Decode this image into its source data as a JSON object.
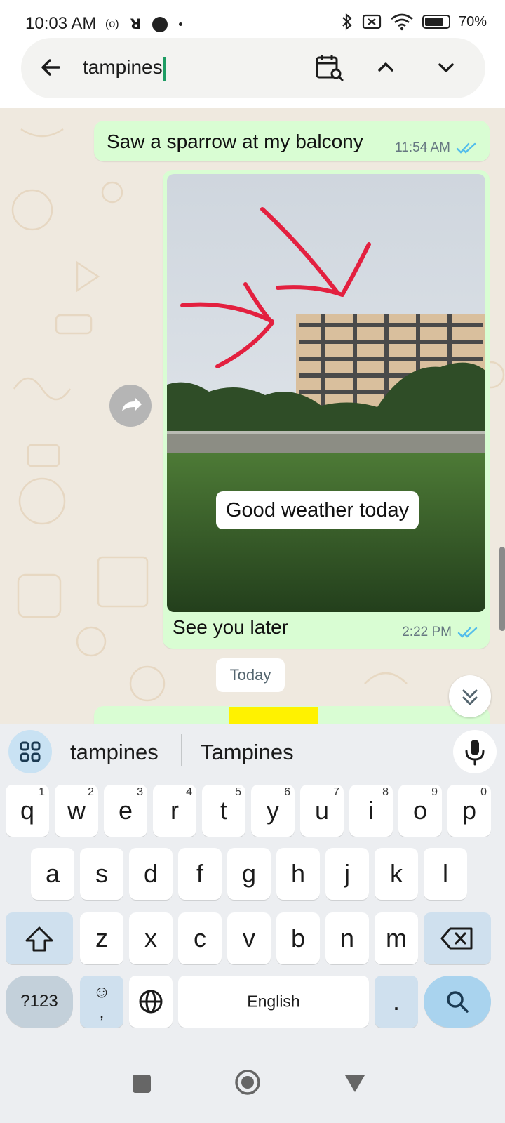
{
  "status_bar": {
    "time": "10:03 AM",
    "battery": "70%",
    "icons": [
      "radio-icon",
      "nfc-icon",
      "notification-dot-icon",
      "bluetooth-icon",
      "sim-off-icon",
      "wifi-icon",
      "battery-icon"
    ]
  },
  "search": {
    "query": "tampines"
  },
  "messages": [
    {
      "text": "Saw a sparrow at my balcony",
      "time": "11:54 AM"
    },
    {
      "image_caption": "Good weather today",
      "text": "See you later",
      "time": "2:22 PM"
    }
  ],
  "date_divider": "Today",
  "keyboard": {
    "suggestions": [
      "tampines",
      "Tampines"
    ],
    "row1": [
      {
        "k": "q",
        "n": "1"
      },
      {
        "k": "w",
        "n": "2"
      },
      {
        "k": "e",
        "n": "3"
      },
      {
        "k": "r",
        "n": "4"
      },
      {
        "k": "t",
        "n": "5"
      },
      {
        "k": "y",
        "n": "6"
      },
      {
        "k": "u",
        "n": "7"
      },
      {
        "k": "i",
        "n": "8"
      },
      {
        "k": "o",
        "n": "9"
      },
      {
        "k": "p",
        "n": "0"
      }
    ],
    "row2": [
      "a",
      "s",
      "d",
      "f",
      "g",
      "h",
      "j",
      "k",
      "l"
    ],
    "row3": [
      "z",
      "x",
      "c",
      "v",
      "b",
      "n",
      "m"
    ],
    "symbols_label": "?123",
    "emoji_label": "☺\n,",
    "space_label": "English",
    "period_label": "."
  },
  "colors": {
    "bubble": "#d9fdd3",
    "read_ticks": "#53bdeb",
    "highlight": "#fff200",
    "caret": "#1d9c63"
  }
}
